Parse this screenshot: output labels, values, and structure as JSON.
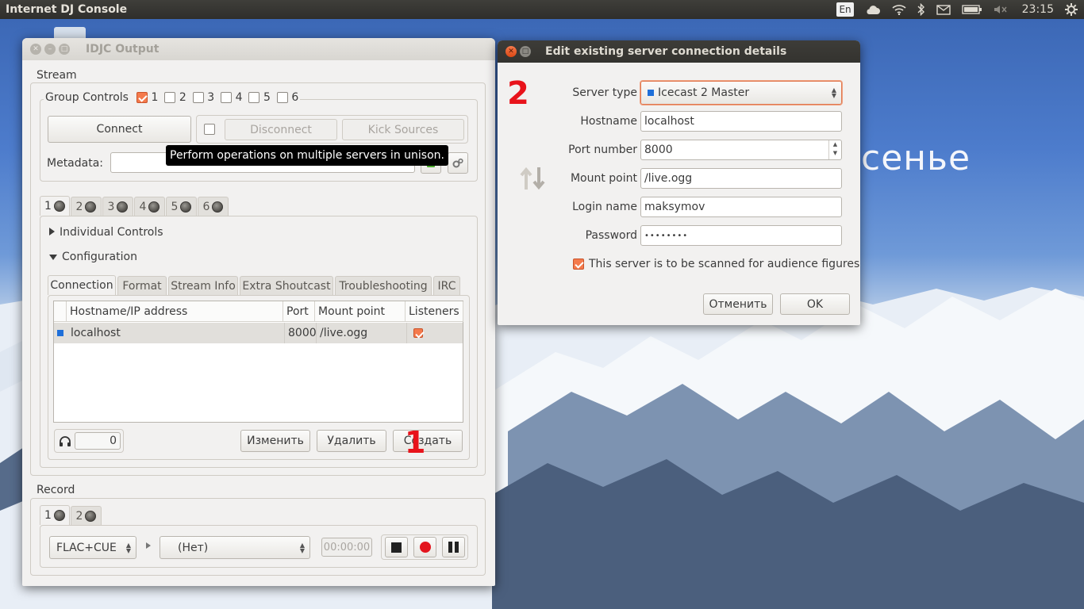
{
  "panel": {
    "app_title": "Internet DJ Console",
    "keyboard_layout": "En",
    "time": "23:15",
    "icons": [
      "cloud-icon",
      "wifi-icon",
      "bluetooth-icon",
      "mail-icon",
      "battery-icon",
      "volume-muted-icon",
      "gear-icon"
    ]
  },
  "desktop": {
    "text": "сенье"
  },
  "output_window": {
    "title": "IDJC Output",
    "stream": {
      "label": "Stream",
      "group_controls": {
        "label": "Group Controls",
        "checks": [
          {
            "label": "1",
            "checked": true
          },
          {
            "label": "2",
            "checked": false
          },
          {
            "label": "3",
            "checked": false
          },
          {
            "label": "4",
            "checked": false
          },
          {
            "label": "5",
            "checked": false
          },
          {
            "label": "6",
            "checked": false
          }
        ],
        "connect_label": "Connect",
        "disconnect_label": "Disconnect",
        "kick_sources_label": "Kick Sources",
        "metadata_label": "Metadata:",
        "tooltip": "Perform operations on multiple servers in unison."
      },
      "server_tabs": [
        "1",
        "2",
        "3",
        "4",
        "5",
        "6"
      ],
      "individual_controls_label": "Individual Controls",
      "configuration_label": "Configuration",
      "config_tabs": [
        "Connection",
        "Format",
        "Stream Info",
        "Extra Shoutcast",
        "Troubleshooting",
        "IRC"
      ],
      "table": {
        "headers": [
          "Hostname/IP address",
          "Port",
          "Mount point",
          "Listeners"
        ],
        "rows": [
          {
            "host": "localhost",
            "port": "8000",
            "mount": "/live.ogg",
            "listeners": true
          }
        ]
      },
      "listener_count": "0",
      "edit_label": "Изменить",
      "delete_label": "Удалить",
      "create_label": "Создать",
      "annotation": "1"
    },
    "record": {
      "label": "Record",
      "tabs": [
        "1",
        "2"
      ],
      "format": "FLAC+CUE",
      "source": "(Нет)",
      "time": "00:00:00"
    }
  },
  "dialog": {
    "title": "Edit existing server connection details",
    "annotation": "2",
    "fields": {
      "server_type_label": "Server type",
      "server_type": "Icecast 2 Master",
      "hostname_label": "Hostname",
      "hostname": "localhost",
      "port_label": "Port number",
      "port": "8000",
      "mount_label": "Mount point",
      "mount": "/live.ogg",
      "login_label": "Login name",
      "login": "maksymov",
      "password_label": "Password",
      "password": "••••••••",
      "scan_label": "This server is to be scanned for audience figures"
    },
    "cancel_label": "Отменить",
    "ok_label": "OK"
  }
}
